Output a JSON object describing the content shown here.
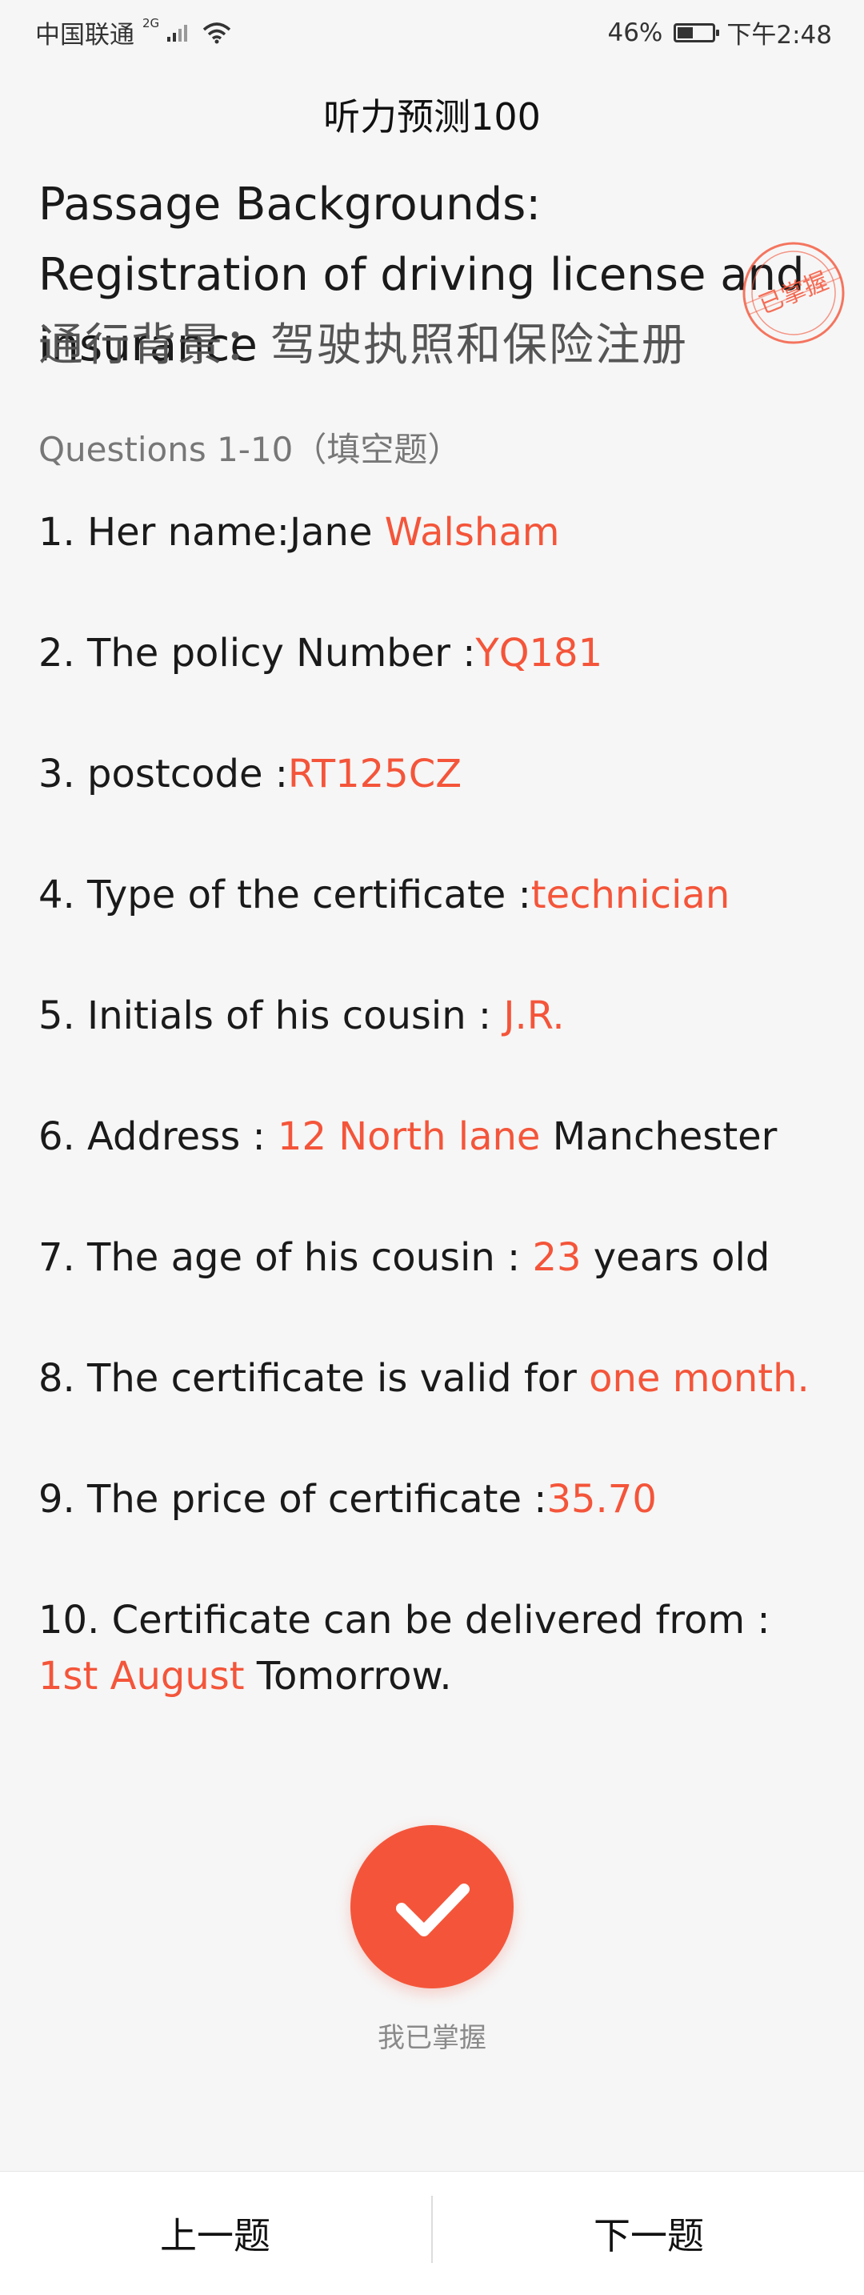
{
  "status_bar": {
    "carrier": "中国联通",
    "network": "2G",
    "battery_percent": "46%",
    "battery_level": 0.46,
    "time": "下午2:48"
  },
  "header": {
    "title": "听力预测100"
  },
  "passage": {
    "title_en": "Passage Backgrounds: Registration of driving license and insurance",
    "title_cn": "通行背景：驾驶执照和保险注册",
    "stamp_text": "已掌握"
  },
  "section": {
    "heading": "Questions 1-10（填空题）"
  },
  "questions": [
    {
      "before": "1. Her name:Jane ",
      "answer": "Walsham",
      "after": ""
    },
    {
      "before": "2. The policy Number :",
      "answer": "YQ181",
      "after": ""
    },
    {
      "before": "3. postcode :",
      "answer": "RT125CZ",
      "after": ""
    },
    {
      "before": "4. Type of the certificate :",
      "answer": "technician",
      "after": ""
    },
    {
      "before": "5. Initials of his cousin : ",
      "answer": "J.R.",
      "after": ""
    },
    {
      "before": "6. Address : ",
      "answer": "12 North lane",
      "after": " Manchester"
    },
    {
      "before": "7. The age of his cousin : ",
      "answer": "23",
      "after": " years old"
    },
    {
      "before": "8. The certificate is valid for ",
      "answer": "one month.",
      "after": ""
    },
    {
      "before": "9. The price of certificate :",
      "answer": "35.70",
      "after": ""
    },
    {
      "before": "10. Certificate can be delivered from : ",
      "answer": "1st August",
      "after": " Tomorrow."
    }
  ],
  "mastered": {
    "label": "我已掌握",
    "icon": "check-icon"
  },
  "bottom_nav": {
    "prev_label": "上一题",
    "next_label": "下一题"
  },
  "colors": {
    "accent": "#f4553a",
    "background": "#f6f6f6"
  }
}
